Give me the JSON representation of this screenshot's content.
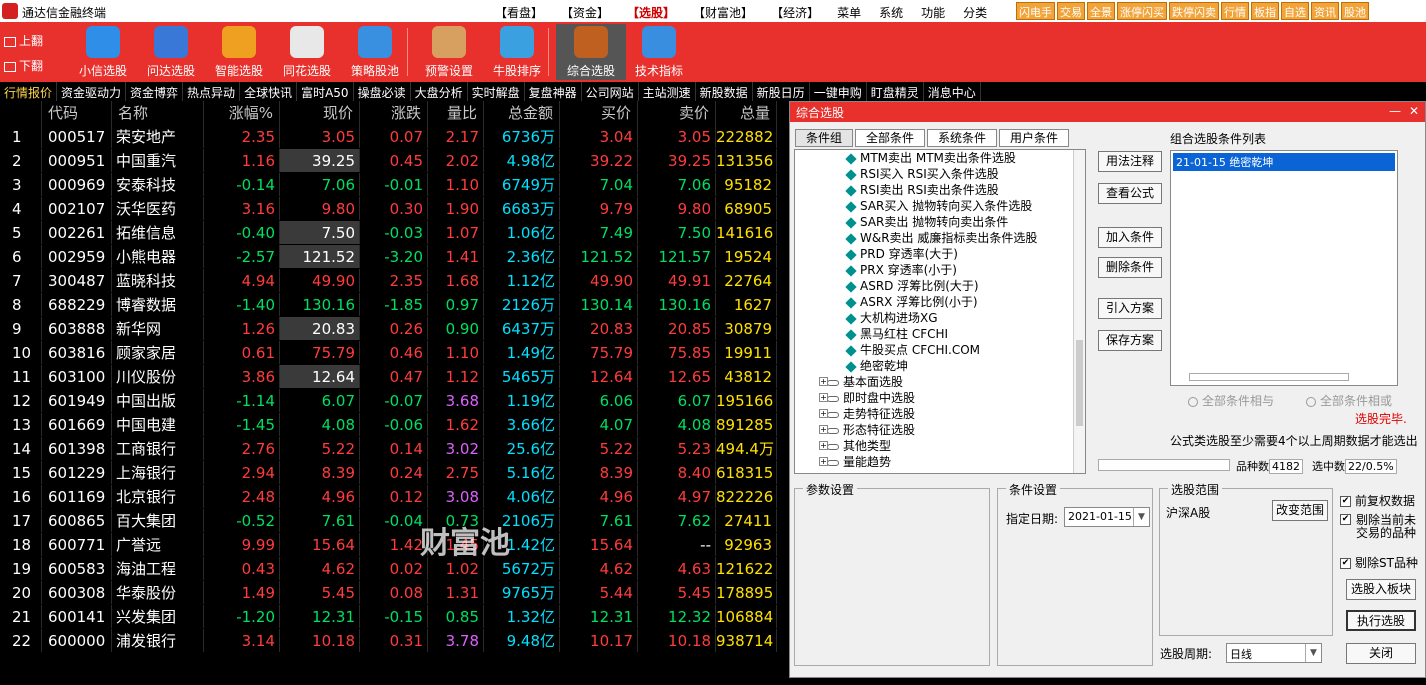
{
  "app": {
    "title": "通达信金融终端"
  },
  "menu": {
    "items": [
      "【看盘】",
      "【资金】",
      "【选股】",
      "【财富池】",
      "【经济】",
      "菜单",
      "系统",
      "功能",
      "分类"
    ],
    "active_index": 2
  },
  "quick": [
    "闪电手",
    "交易",
    "全景",
    "涨停闪买",
    "跌停闪卖",
    "行情",
    "板指",
    "自选",
    "资讯",
    "股池"
  ],
  "toolbar": {
    "pager": [
      "上翻",
      "下翻"
    ],
    "buttons": [
      {
        "label": "小信选股",
        "icon": "r-circle-icon",
        "color": "#2f8fe8"
      },
      {
        "label": "问达选股",
        "icon": "magnifier-icon",
        "color": "#3a78d8"
      },
      {
        "label": "智能选股",
        "icon": "book-icon",
        "color": "#f0a020"
      },
      {
        "label": "同花选股",
        "icon": "flower-check-icon",
        "color": "#e8e8e8"
      },
      {
        "label": "策略股池",
        "icon": "swap-arrows-icon",
        "color": "#3a90e0"
      },
      {
        "label": "预警设置",
        "icon": "alarm-box-icon",
        "color": "#d8a060"
      },
      {
        "label": "牛股排序",
        "icon": "sort-arrows-icon",
        "color": "#3aa0e0"
      },
      {
        "label": "综合选股",
        "icon": "cursor-icon",
        "color": "#c06020"
      },
      {
        "label": "技术指标",
        "icon": "line-chart-icon",
        "color": "#3a8ee0"
      }
    ],
    "selected_index": 7
  },
  "tabs": {
    "items": [
      "行情报价",
      "资金驱动力",
      "资金博弈",
      "热点异动",
      "全球快讯",
      "富时A50",
      "操盘必读",
      "大盘分析",
      "实时解盘",
      "复盘神器",
      "公司网站",
      "主站测速",
      "新股数据",
      "新股日历",
      "一键申购",
      "盯盘精灵",
      "消息中心"
    ],
    "active_index": 0
  },
  "quote": {
    "columns": [
      "",
      "代码",
      "名称",
      "涨幅%",
      "现价",
      "涨跌",
      "量比",
      "总金额",
      "买价",
      "卖价",
      "总量"
    ],
    "rows": [
      {
        "n": "1",
        "code": "000517",
        "name": "荣安地产",
        "pct": "2.35",
        "price": "3.05",
        "chg": "0.07",
        "vr": "2.17",
        "amt": "6736万",
        "bid": "3.04",
        "ask": "3.05",
        "vol": "222882",
        "dir": "up",
        "vrc": "up",
        "hl": false
      },
      {
        "n": "2",
        "code": "000951",
        "name": "中国重汽",
        "pct": "1.16",
        "price": "39.25",
        "chg": "0.45",
        "vr": "2.02",
        "amt": "4.98亿",
        "bid": "39.22",
        "ask": "39.25",
        "vol": "131356",
        "dir": "up",
        "vrc": "up",
        "hl": true
      },
      {
        "n": "3",
        "code": "000969",
        "name": "安泰科技",
        "pct": "-0.14",
        "price": "7.06",
        "chg": "-0.01",
        "vr": "1.10",
        "amt": "6749万",
        "bid": "7.04",
        "ask": "7.06",
        "vol": "95182",
        "dir": "dn",
        "vrc": "up",
        "hl": false
      },
      {
        "n": "4",
        "code": "002107",
        "name": "沃华医药",
        "pct": "3.16",
        "price": "9.80",
        "chg": "0.30",
        "vr": "1.90",
        "amt": "6683万",
        "bid": "9.79",
        "ask": "9.80",
        "vol": "68905",
        "dir": "up",
        "vrc": "up",
        "hl": false
      },
      {
        "n": "5",
        "code": "002261",
        "name": "拓维信息",
        "pct": "-0.40",
        "price": "7.50",
        "chg": "-0.03",
        "vr": "1.07",
        "amt": "1.06亿",
        "bid": "7.49",
        "ask": "7.50",
        "vol": "141616",
        "dir": "dn",
        "vrc": "up",
        "hl": true
      },
      {
        "n": "6",
        "code": "002959",
        "name": "小熊电器",
        "pct": "-2.57",
        "price": "121.52",
        "chg": "-3.20",
        "vr": "1.41",
        "amt": "2.36亿",
        "bid": "121.52",
        "ask": "121.57",
        "vol": "19524",
        "dir": "dn",
        "vrc": "up",
        "hl": true
      },
      {
        "n": "7",
        "code": "300487",
        "name": "蓝晓科技",
        "pct": "4.94",
        "price": "49.90",
        "chg": "2.35",
        "vr": "1.68",
        "amt": "1.12亿",
        "bid": "49.90",
        "ask": "49.91",
        "vol": "22764",
        "dir": "up",
        "vrc": "up",
        "hl": false
      },
      {
        "n": "8",
        "code": "688229",
        "name": "博睿数据",
        "pct": "-1.40",
        "price": "130.16",
        "chg": "-1.85",
        "vr": "0.97",
        "amt": "2126万",
        "bid": "130.14",
        "ask": "130.16",
        "vol": "1627",
        "dir": "dn",
        "vrc": "dn",
        "hl": false
      },
      {
        "n": "9",
        "code": "603888",
        "name": "新华网",
        "pct": "1.26",
        "price": "20.83",
        "chg": "0.26",
        "vr": "0.90",
        "amt": "6437万",
        "bid": "20.83",
        "ask": "20.85",
        "vol": "30879",
        "dir": "up",
        "vrc": "dn",
        "hl": true
      },
      {
        "n": "10",
        "code": "603816",
        "name": "顾家家居",
        "pct": "0.61",
        "price": "75.79",
        "chg": "0.46",
        "vr": "1.10",
        "amt": "1.49亿",
        "bid": "75.79",
        "ask": "75.85",
        "vol": "19911",
        "dir": "up",
        "vrc": "up",
        "hl": false
      },
      {
        "n": "11",
        "code": "603100",
        "name": "川仪股份",
        "pct": "3.86",
        "price": "12.64",
        "chg": "0.47",
        "vr": "1.12",
        "amt": "5465万",
        "bid": "12.64",
        "ask": "12.65",
        "vol": "43812",
        "dir": "up",
        "vrc": "up",
        "hl": true
      },
      {
        "n": "12",
        "code": "601949",
        "name": "中国出版",
        "pct": "-1.14",
        "price": "6.07",
        "chg": "-0.07",
        "vr": "3.68",
        "amt": "1.19亿",
        "bid": "6.06",
        "ask": "6.07",
        "vol": "195166",
        "dir": "dn",
        "vrc": "purple",
        "hl": false
      },
      {
        "n": "13",
        "code": "601669",
        "name": "中国电建",
        "pct": "-1.45",
        "price": "4.08",
        "chg": "-0.06",
        "vr": "1.62",
        "amt": "3.66亿",
        "bid": "4.07",
        "ask": "4.08",
        "vol": "891285",
        "dir": "dn",
        "vrc": "up",
        "hl": false
      },
      {
        "n": "14",
        "code": "601398",
        "name": "工商银行",
        "pct": "2.76",
        "price": "5.22",
        "chg": "0.14",
        "vr": "3.02",
        "amt": "25.6亿",
        "bid": "5.22",
        "ask": "5.23",
        "vol": "494.4万",
        "dir": "up",
        "vrc": "purple",
        "hl": false
      },
      {
        "n": "15",
        "code": "601229",
        "name": "上海银行",
        "pct": "2.94",
        "price": "8.39",
        "chg": "0.24",
        "vr": "2.75",
        "amt": "5.16亿",
        "bid": "8.39",
        "ask": "8.40",
        "vol": "618315",
        "dir": "up",
        "vrc": "up",
        "hl": false
      },
      {
        "n": "16",
        "code": "601169",
        "name": "北京银行",
        "pct": "2.48",
        "price": "4.96",
        "chg": "0.12",
        "vr": "3.08",
        "amt": "4.06亿",
        "bid": "4.96",
        "ask": "4.97",
        "vol": "822226",
        "dir": "up",
        "vrc": "purple",
        "hl": false
      },
      {
        "n": "17",
        "code": "600865",
        "name": "百大集团",
        "pct": "-0.52",
        "price": "7.61",
        "chg": "-0.04",
        "vr": "0.73",
        "amt": "2106万",
        "bid": "7.61",
        "ask": "7.62",
        "vol": "27411",
        "dir": "dn",
        "vrc": "dn",
        "hl": false
      },
      {
        "n": "18",
        "code": "600771",
        "name": "广誉远",
        "pct": "9.99",
        "price": "15.64",
        "chg": "1.42",
        "vr": "1.45",
        "amt": "1.42亿",
        "bid": "15.64",
        "ask": "--",
        "vol": "92963",
        "dir": "up",
        "vrc": "up",
        "hl": false
      },
      {
        "n": "19",
        "code": "600583",
        "name": "海油工程",
        "pct": "0.43",
        "price": "4.62",
        "chg": "0.02",
        "vr": "1.02",
        "amt": "5672万",
        "bid": "4.62",
        "ask": "4.63",
        "vol": "121622",
        "dir": "up",
        "vrc": "up",
        "hl": false
      },
      {
        "n": "20",
        "code": "600308",
        "name": "华泰股份",
        "pct": "1.49",
        "price": "5.45",
        "chg": "0.08",
        "vr": "1.31",
        "amt": "9765万",
        "bid": "5.44",
        "ask": "5.45",
        "vol": "178895",
        "dir": "up",
        "vrc": "up",
        "hl": false
      },
      {
        "n": "21",
        "code": "600141",
        "name": "兴发集团",
        "pct": "-1.20",
        "price": "12.31",
        "chg": "-0.15",
        "vr": "0.85",
        "amt": "1.32亿",
        "bid": "12.31",
        "ask": "12.32",
        "vol": "106884",
        "dir": "dn",
        "vrc": "dn",
        "hl": false
      },
      {
        "n": "22",
        "code": "600000",
        "name": "浦发银行",
        "pct": "3.14",
        "price": "10.18",
        "chg": "0.31",
        "vr": "3.78",
        "amt": "9.48亿",
        "bid": "10.17",
        "ask": "10.18",
        "vol": "938714",
        "dir": "up",
        "vrc": "purple",
        "hl": false
      }
    ]
  },
  "dialog": {
    "title": "综合选股",
    "tabs": [
      "条件组",
      "全部条件",
      "系统条件",
      "用户条件"
    ],
    "tree": {
      "leaves": [
        "MTM卖出 MTM卖出条件选股",
        "RSI买入 RSI买入条件选股",
        "RSI卖出 RSI卖出条件选股",
        "SAR买入 抛物转向买入条件选股",
        "SAR卖出 抛物转向卖出条件",
        "W&R卖出 威廉指标卖出条件选股",
        "PRD 穿透率(大于)",
        "PRX 穿透率(小于)",
        "ASRD 浮筹比例(大于)",
        "ASRX 浮筹比例(小于)",
        "大机构进场XG",
        "黑马红柱 CFCHI",
        "牛股买点 CFCHI.COM",
        "绝密乾坤"
      ],
      "groups": [
        "基本面选股",
        "即时盘中选股",
        "走势特征选股",
        "形态特征选股",
        "其他类型",
        "量能趋势"
      ]
    },
    "buttons": {
      "explain": "用法注释",
      "view_formula": "查看公式",
      "add": "加入条件",
      "remove": "删除条件",
      "import": "引入方案",
      "save": "保存方案"
    },
    "list_label": "组合选股条件列表",
    "list_items": [
      "21-01-15 绝密乾坤"
    ],
    "radio_and": "全部条件相与",
    "radio_or": "全部条件相或",
    "done": "选股完毕.",
    "need_note": "公式类选股至少需要4个以上周期数据才能选出",
    "stock_count_label": "品种数",
    "stock_count": "4182",
    "selected_label": "选中数",
    "selected": "22/0.5%",
    "params_label": "参数设置",
    "cond_label": "条件设置",
    "date_label": "指定日期:",
    "date": "2021-01-15",
    "range_label": "选股范围",
    "range_value": "沪深A股",
    "change_range": "改变范围",
    "checks": [
      "前复权数据",
      "剔除当前未交易的品种",
      "剔除ST品种"
    ],
    "to_block": "选股入板块",
    "execute": "执行选股",
    "period_label": "选股周期:",
    "period": "日线",
    "close": "关闭"
  },
  "watermark": "财富池"
}
